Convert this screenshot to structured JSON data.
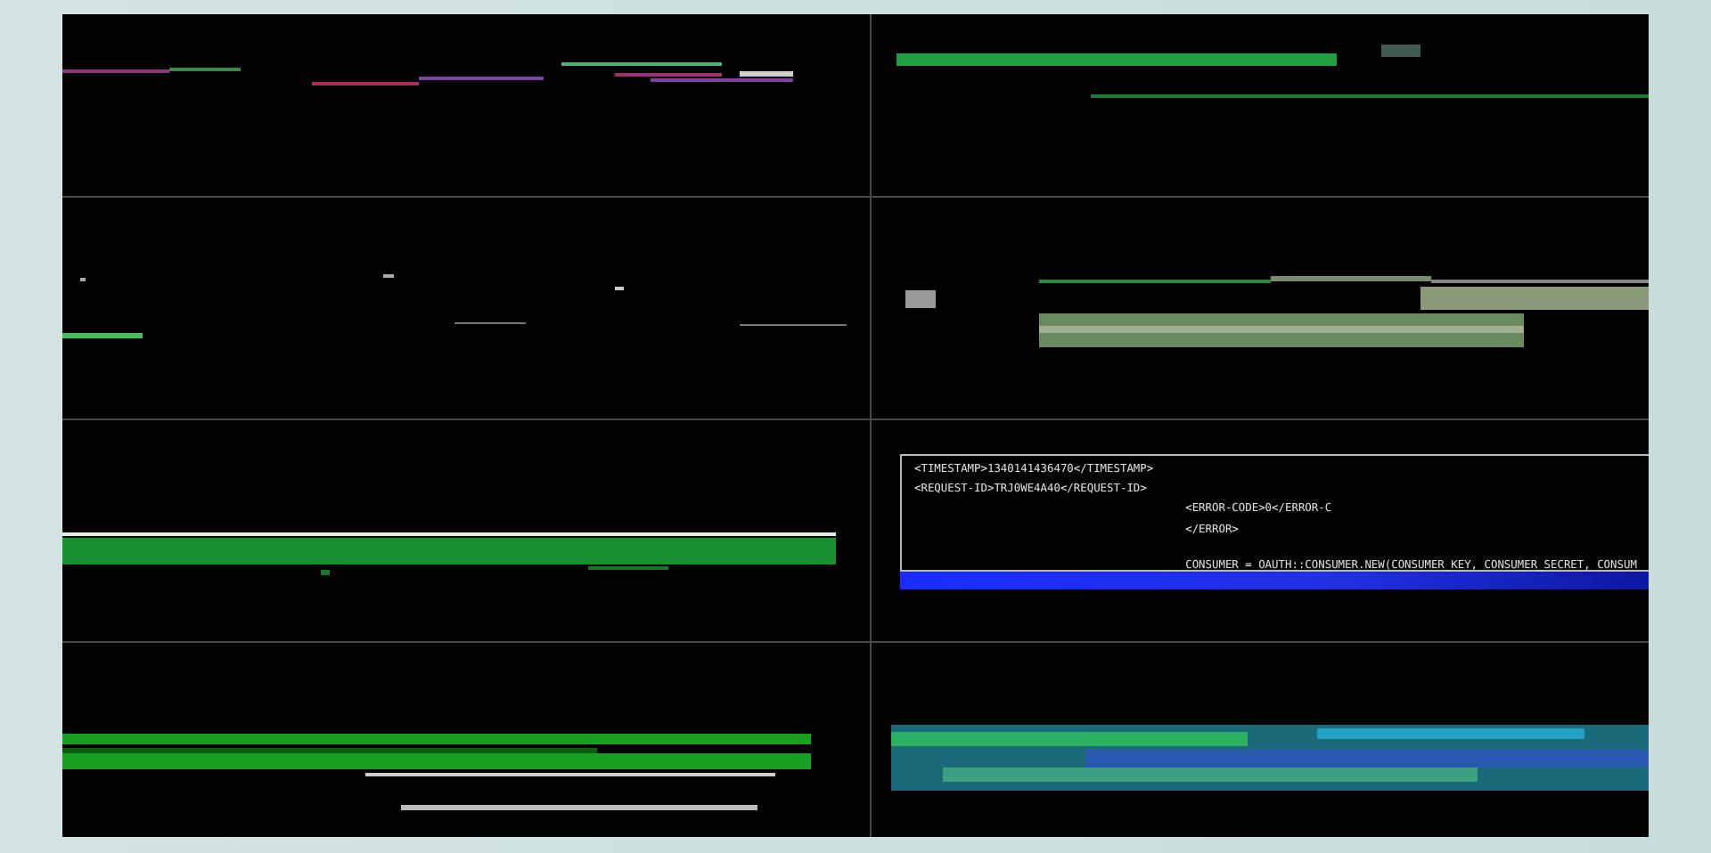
{
  "code_panel": {
    "left_lines": [
      "<TIMESTAMP>1340141436470</TIMESTAMP>",
      "<REQUEST-ID>TRJ0WE4A40</REQUEST-ID>"
    ],
    "right_lines": [
      "<ERROR-CODE>0</ERROR-C",
      "</ERROR>"
    ],
    "statement": "CONSUMER = OAUTH::CONSUMER.NEW(CONSUMER_KEY, CONSUMER_SECRET, CONSUM"
  }
}
